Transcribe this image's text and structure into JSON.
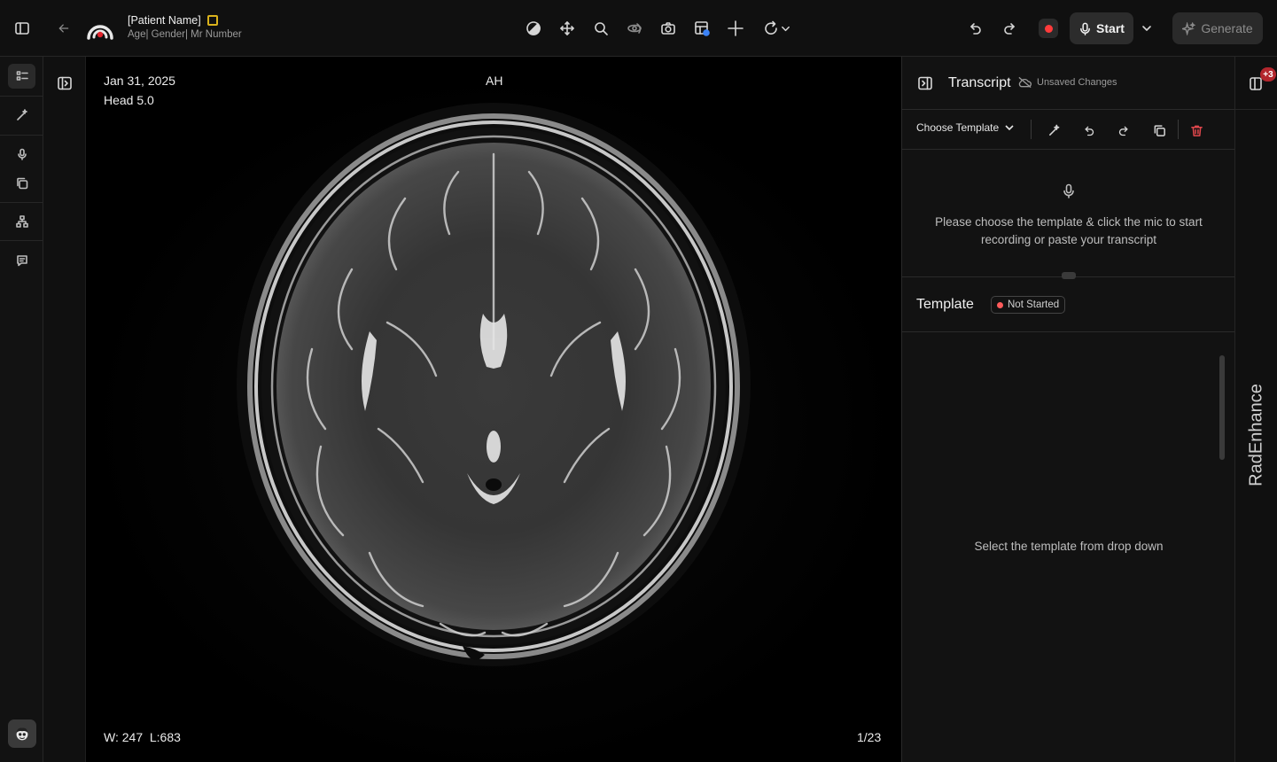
{
  "patient": {
    "name": "[Patient Name]",
    "meta": "Age| Gender| Mr Number"
  },
  "topbar": {
    "start_label": "Start",
    "generate_label": "Generate",
    "tools": [
      "contrast-icon",
      "pan-icon",
      "zoom-icon",
      "rotate-3d-icon",
      "camera-icon",
      "grid-layout-icon",
      "crosshair-icon",
      "rotate-icon"
    ]
  },
  "viewer": {
    "date": "Jan 31, 2025",
    "series": "Head 5.0",
    "orientation": "AH",
    "window_level": "W: 247  L:683",
    "slice": "1/23"
  },
  "transcript": {
    "title": "Transcript",
    "unsaved": "Unsaved Changes",
    "choose_template": "Choose Template",
    "mic_message": "Please choose the template & click the mic to start recording or paste your transcript"
  },
  "template": {
    "title": "Template",
    "status": "Not Started",
    "status_color": "#ff5b5b",
    "empty_message": "Select the template from drop down"
  },
  "right_rail": {
    "badge": "+3",
    "label": "RadEnhance"
  },
  "colors": {
    "background": "#000000",
    "panel": "#121212",
    "record": "#ff3b3b",
    "delete": "#e0474c"
  }
}
